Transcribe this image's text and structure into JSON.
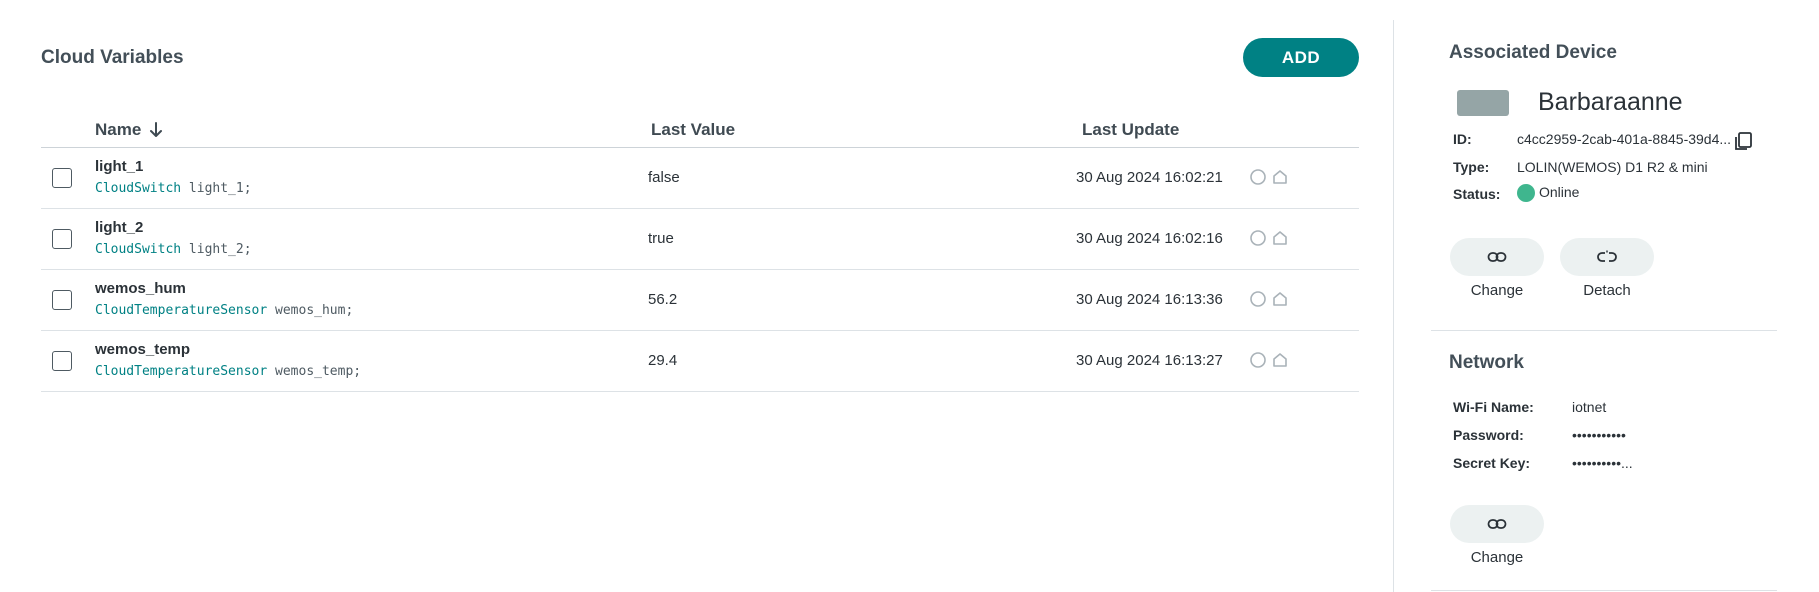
{
  "variables_panel": {
    "title": "Cloud Variables",
    "add_label": "ADD",
    "columns": {
      "name": "Name",
      "last_value": "Last Value",
      "last_update": "Last Update"
    },
    "rows": [
      {
        "name": "light_1",
        "type": "CloudSwitch",
        "decl": " light_1;",
        "value": "false",
        "updated": "30 Aug 2024 16:02:21"
      },
      {
        "name": "light_2",
        "type": "CloudSwitch",
        "decl": " light_2;",
        "value": "true",
        "updated": "30 Aug 2024 16:02:16"
      },
      {
        "name": "wemos_hum",
        "type": "CloudTemperatureSensor",
        "decl": " wemos_hum;",
        "value": "56.2",
        "updated": "30 Aug 2024 16:13:36"
      },
      {
        "name": "wemos_temp",
        "type": "CloudTemperatureSensor",
        "decl": " wemos_temp;",
        "value": "29.4",
        "updated": "30 Aug 2024 16:13:27"
      }
    ]
  },
  "device": {
    "title": "Associated Device",
    "name": "Barbaraanne",
    "id_label": "ID:",
    "id_value": "c4cc2959-2cab-401a-8845-39d4...",
    "type_label": "Type:",
    "type_value": "LOLIN(WEMOS) D1 R2 & mini",
    "status_label": "Status:",
    "status_value": "Online",
    "change_label": "Change",
    "detach_label": "Detach"
  },
  "network": {
    "title": "Network",
    "wifi_label": "Wi-Fi Name:",
    "wifi_value": "iotnet",
    "password_label": "Password:",
    "password_value": "•••••••••••",
    "secret_label": "Secret Key:",
    "secret_value": "••••••••••...",
    "change_label": "Change"
  },
  "colors": {
    "accent": "#008184",
    "status_online": "#3fb68e",
    "pill_bg": "#ecf1f1"
  }
}
